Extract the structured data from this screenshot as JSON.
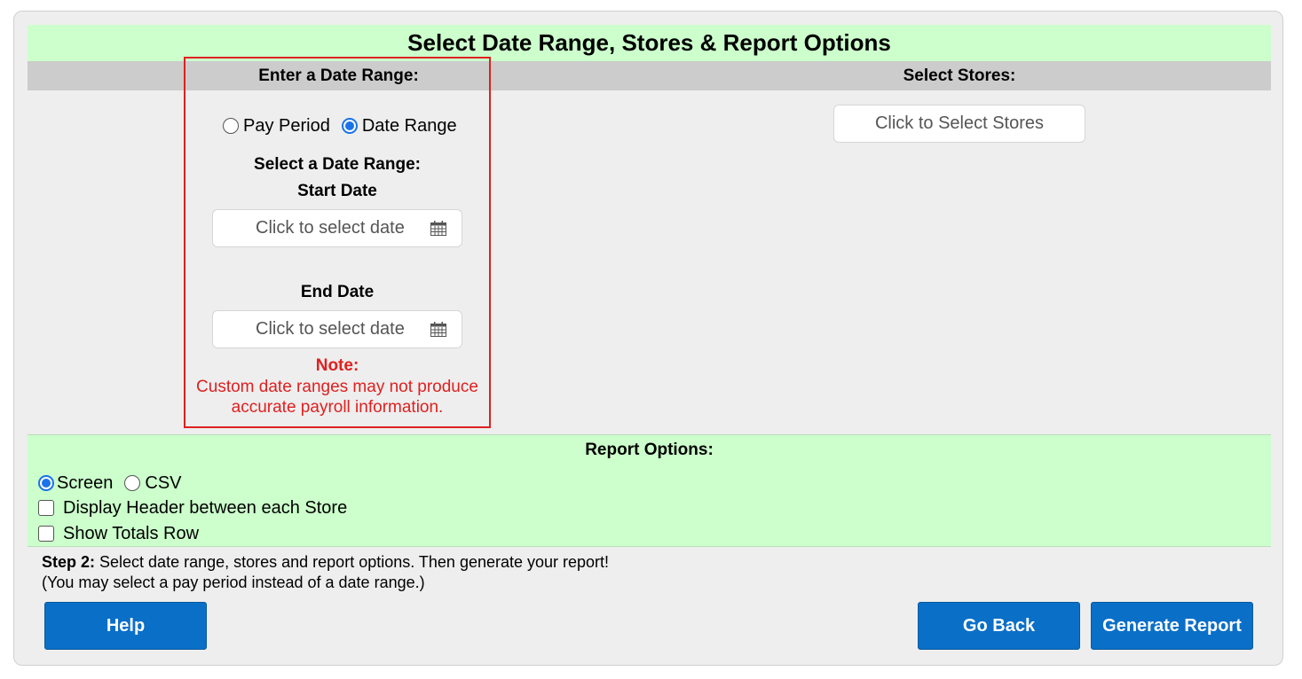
{
  "title": "Select Date Range, Stores & Report Options",
  "date_section": {
    "heading": "Enter a Date Range:",
    "mode_options": [
      {
        "label": "Pay Period",
        "checked": false
      },
      {
        "label": "Date Range",
        "checked": true
      }
    ],
    "select_range_label": "Select a Date Range:",
    "start_label": "Start Date",
    "start_placeholder": "Click to select date",
    "end_label": "End Date",
    "end_placeholder": "Click to select date",
    "note_title": "Note:",
    "note_line1": "Custom date ranges may not produce",
    "note_line2": "accurate payroll information.",
    "highlight_color": "#e02020"
  },
  "stores_section": {
    "heading": "Select Stores:",
    "button_label": "Click to Select Stores"
  },
  "report_options": {
    "heading": "Report Options:",
    "format_options": [
      {
        "label": "Screen",
        "checked": true
      },
      {
        "label": "CSV",
        "checked": false
      }
    ],
    "checkboxes": [
      {
        "label": "Display Header between each Store",
        "checked": false
      },
      {
        "label": "Show Totals Row",
        "checked": false
      }
    ]
  },
  "step": {
    "bold": "Step 2:",
    "text": " Select date range, stores and report options. Then generate your report!",
    "line2": "(You may select a pay period instead of a date range.)"
  },
  "buttons": {
    "help": "Help",
    "go_back": "Go Back",
    "generate": "Generate Report"
  },
  "colors": {
    "accent_green": "#ccffcc",
    "button_blue": "#0a6fc7",
    "header_gray": "#cccccc"
  },
  "icons": {
    "date_picker": "calendar-icon"
  }
}
